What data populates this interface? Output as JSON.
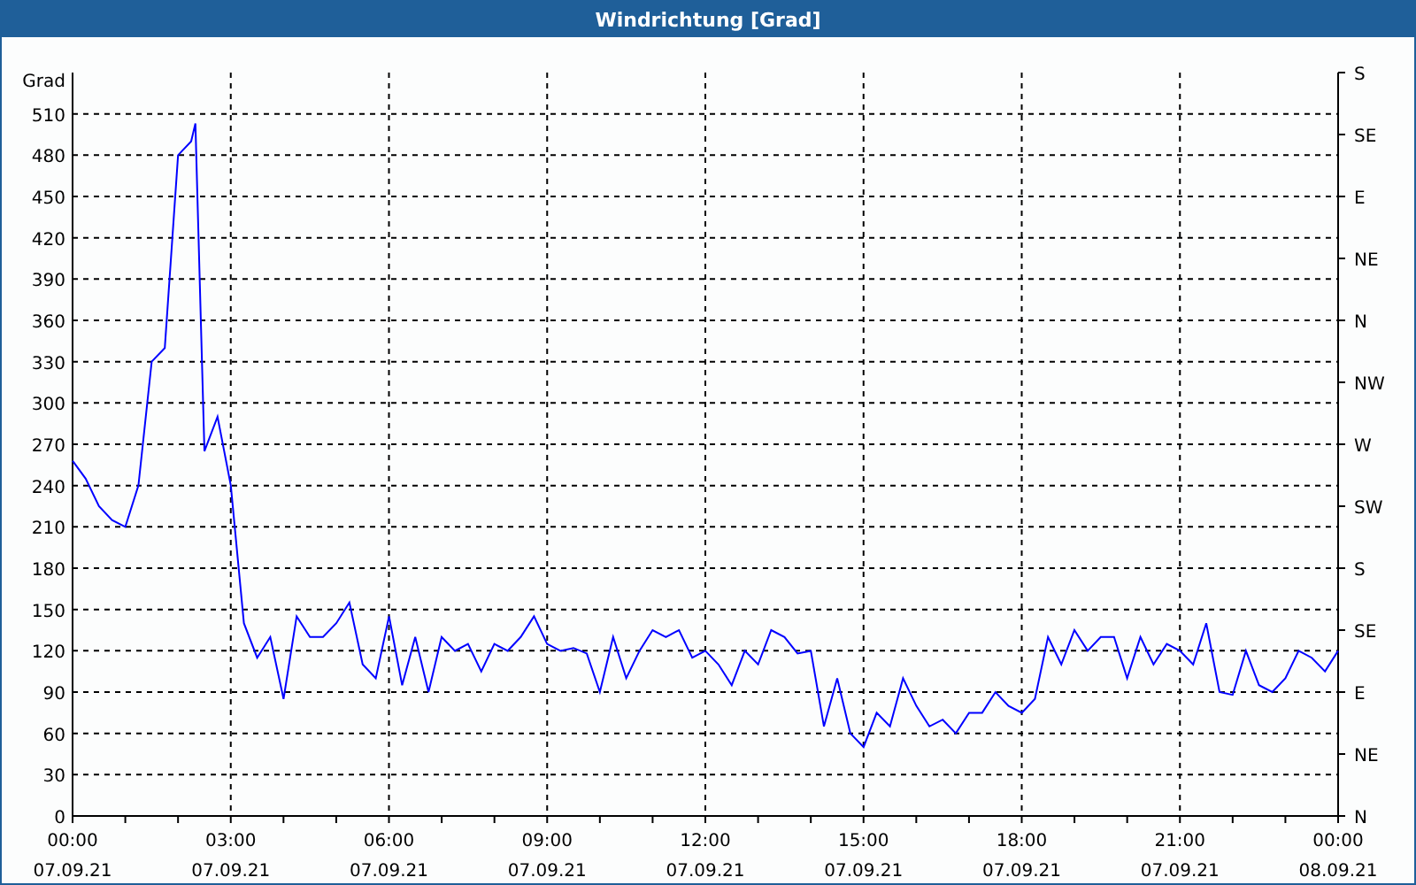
{
  "window": {
    "title": "Windrichtung [Grad]"
  },
  "chart": {
    "chart_data": {
      "type": "line",
      "grid": true,
      "ylabel": "Grad",
      "xlim": [
        0,
        24
      ],
      "ylim": [
        0,
        540
      ],
      "x": [
        0,
        0.25,
        0.5,
        0.75,
        1,
        1.25,
        1.5,
        1.75,
        2,
        2.25,
        2.33,
        2.5,
        2.75,
        3,
        3.25,
        3.5,
        3.75,
        4,
        4.25,
        4.5,
        4.75,
        5,
        5.25,
        5.5,
        5.75,
        6,
        6.25,
        6.5,
        6.75,
        7,
        7.25,
        7.5,
        7.75,
        8,
        8.25,
        8.5,
        8.75,
        9,
        9.25,
        9.5,
        9.75,
        10,
        10.25,
        10.5,
        10.75,
        11,
        11.25,
        11.5,
        11.75,
        12,
        12.25,
        12.5,
        12.75,
        13,
        13.25,
        13.5,
        13.75,
        14,
        14.25,
        14.5,
        14.75,
        15,
        15.25,
        15.5,
        15.75,
        16,
        16.25,
        16.5,
        16.75,
        17,
        17.25,
        17.5,
        17.75,
        18,
        18.25,
        18.5,
        18.75,
        19,
        19.25,
        19.5,
        19.75,
        20,
        20.25,
        20.5,
        20.75,
        21,
        21.25,
        21.5,
        21.75,
        22,
        22.25,
        22.5,
        22.75,
        23,
        23.25,
        23.5,
        23.75,
        24
      ],
      "series": [
        {
          "color": "#0000ff",
          "values": [
            258,
            245,
            225,
            215,
            210,
            240,
            330,
            340,
            480,
            490,
            503,
            265,
            290,
            240,
            140,
            115,
            130,
            85,
            145,
            130,
            130,
            140,
            155,
            110,
            100,
            145,
            95,
            130,
            90,
            130,
            120,
            125,
            105,
            125,
            120,
            130,
            145,
            125,
            120,
            122,
            118,
            90,
            130,
            100,
            120,
            135,
            130,
            135,
            115,
            120,
            110,
            95,
            120,
            110,
            135,
            130,
            118,
            120,
            65,
            100,
            60,
            50,
            75,
            65,
            100,
            80,
            65,
            70,
            60,
            75,
            75,
            90,
            80,
            75,
            85,
            130,
            110,
            135,
            120,
            130,
            130,
            100,
            130,
            110,
            125,
            120,
            110,
            140,
            90,
            88,
            120,
            95,
            90,
            100,
            120,
            115,
            105,
            120
          ]
        }
      ],
      "xticks": [
        {
          "value": 0,
          "label": "00:00"
        },
        {
          "value": 3,
          "label": "03:00"
        },
        {
          "value": 6,
          "label": "06:00"
        },
        {
          "value": 9,
          "label": "09:00"
        },
        {
          "value": 12,
          "label": "12:00"
        },
        {
          "value": 15,
          "label": "15:00"
        },
        {
          "value": 18,
          "label": "18:00"
        },
        {
          "value": 21,
          "label": "21:00"
        },
        {
          "value": 24,
          "label": "00:00"
        }
      ],
      "yticks": [
        0,
        30,
        60,
        90,
        120,
        150,
        180,
        210,
        240,
        270,
        300,
        330,
        360,
        390,
        420,
        450,
        480,
        510
      ]
    },
    "x_dates": [
      "07.09.21",
      "07.09.21",
      "07.09.21",
      "07.09.21",
      "07.09.21",
      "07.09.21",
      "07.09.21",
      "07.09.21",
      "08.09.21"
    ],
    "compass_labels": [
      "S",
      "SE",
      "E",
      "NE",
      "N",
      "NW",
      "W",
      "SW",
      "S",
      "SE",
      "E",
      "NE",
      "N"
    ]
  }
}
